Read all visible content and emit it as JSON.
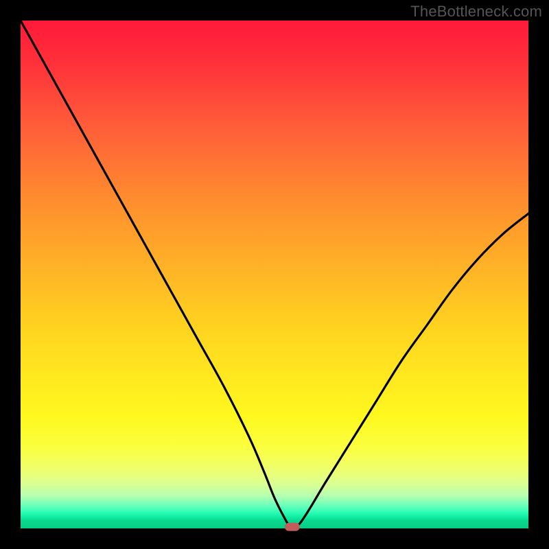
{
  "watermark": "TheBottleneck.com",
  "chart_data": {
    "type": "line",
    "title": "",
    "xlabel": "",
    "ylabel": "",
    "xlim": [
      0,
      100
    ],
    "ylim": [
      0,
      100
    ],
    "grid": false,
    "legend": false,
    "series": [
      {
        "name": "bottleneck-curve",
        "type": "line",
        "color": "#000000",
        "x": [
          0,
          5,
          10,
          15,
          20,
          25,
          30,
          35,
          40,
          45,
          48,
          50,
          52,
          53,
          54,
          55,
          57,
          60,
          65,
          70,
          75,
          80,
          85,
          90,
          95,
          100
        ],
        "y": [
          100,
          91,
          82,
          73,
          64,
          55,
          46,
          37,
          28,
          18,
          11,
          6,
          2,
          0.5,
          0.5,
          1,
          4,
          9,
          17,
          25,
          33,
          40,
          47,
          53,
          58,
          62
        ]
      }
    ],
    "annotations": [
      {
        "type": "marker",
        "shape": "rounded-rect",
        "x": 53.5,
        "y": 0.3,
        "color": "#c25b5b"
      }
    ],
    "background_gradient": {
      "direction": "vertical",
      "stops": [
        {
          "pos": 0.0,
          "color": "#ff1a3a"
        },
        {
          "pos": 0.2,
          "color": "#ff5a3a"
        },
        {
          "pos": 0.48,
          "color": "#ffb127"
        },
        {
          "pos": 0.7,
          "color": "#ffe81f"
        },
        {
          "pos": 0.88,
          "color": "#f0ff6a"
        },
        {
          "pos": 0.95,
          "color": "#7effb9"
        },
        {
          "pos": 1.0,
          "color": "#06cc83"
        }
      ]
    }
  }
}
